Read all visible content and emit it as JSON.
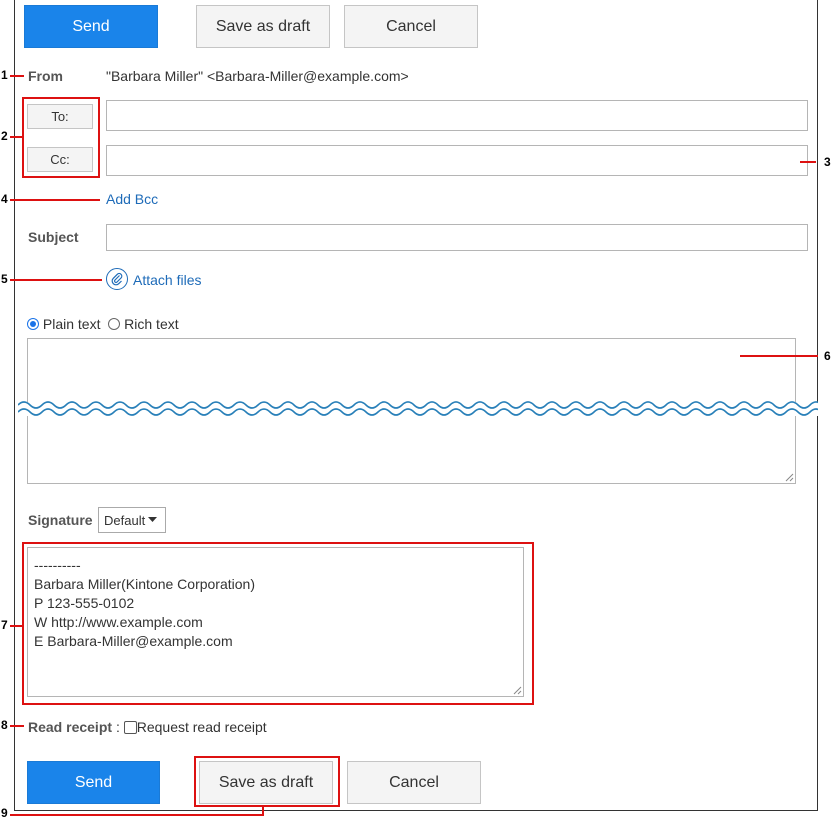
{
  "toolbar_top": {
    "send": "Send",
    "save_draft": "Save as draft",
    "cancel": "Cancel"
  },
  "from": {
    "label": "From",
    "value": "\"Barbara Miller\" <Barbara-Miller@example.com>"
  },
  "recipients": {
    "to_button": "To:",
    "cc_button": "Cc:",
    "add_bcc": "Add Bcc"
  },
  "subject": {
    "label": "Subject"
  },
  "attach": {
    "label": "Attach files"
  },
  "format": {
    "plain": "Plain text",
    "rich": "Rich text",
    "selected": "plain"
  },
  "signature": {
    "label": "Signature",
    "selected": "Default",
    "lines": [
      "----------",
      "Barbara Miller(Kintone Corporation)",
      "P 123-555-0102",
      "W http://www.example.com",
      "E Barbara-Miller@example.com"
    ]
  },
  "read_receipt": {
    "label": "Read receipt",
    "sep": ":",
    "option": "Request read receipt",
    "checked": false
  },
  "toolbar_bottom": {
    "send": "Send",
    "save_draft": "Save as draft",
    "cancel": "Cancel"
  },
  "callouts": [
    "1",
    "2",
    "3",
    "4",
    "5",
    "6",
    "7",
    "8",
    "9"
  ],
  "colors": {
    "primary": "#1a84ea",
    "callout": "#d11",
    "link": "#1e6bb8"
  },
  "icons": {
    "attach": "paperclip-icon",
    "dropdown": "caret-down-icon"
  }
}
